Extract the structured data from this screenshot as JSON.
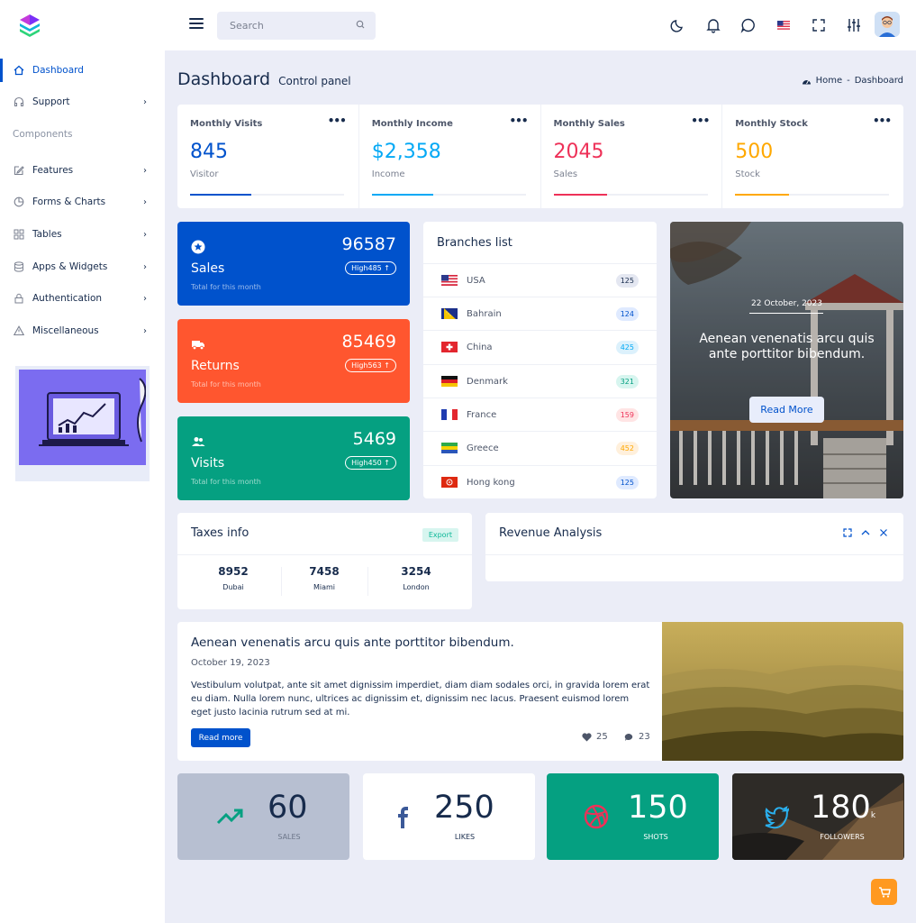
{
  "header": {
    "search_placeholder": "Search"
  },
  "sidebar": {
    "items": [
      {
        "label": "Dashboard",
        "icon": "home-icon",
        "active": true
      },
      {
        "label": "Support",
        "icon": "headphones-icon"
      },
      {
        "label": "Features",
        "icon": "edit-icon"
      },
      {
        "label": "Forms & Charts",
        "icon": "pie-chart-icon"
      },
      {
        "label": "Tables",
        "icon": "grid-icon"
      },
      {
        "label": "Apps & Widgets",
        "icon": "database-icon"
      },
      {
        "label": "Authentication",
        "icon": "lock-icon"
      },
      {
        "label": "Miscellaneous",
        "icon": "warning-icon"
      }
    ],
    "section_heading": "Components"
  },
  "page": {
    "title": "Dashboard",
    "subtitle": "Control panel",
    "breadcrumb_home": "Home",
    "breadcrumb_sep": "-",
    "breadcrumb_current": "Dashboard"
  },
  "stats": [
    {
      "label": "Monthly Visits",
      "value": "845",
      "sub": "Visitor",
      "color": "#0052cc",
      "progress": 0.4
    },
    {
      "label": "Monthly Income",
      "value": "$2,358",
      "sub": "Income",
      "color": "#04a9f5",
      "progress": 0.4
    },
    {
      "label": "Monthly Sales",
      "value": "2045",
      "sub": "Sales",
      "color": "#ee3158",
      "progress": 0.35
    },
    {
      "label": "Monthly Stock",
      "value": "500",
      "sub": "Stock",
      "color": "#ffa800",
      "progress": 0.35
    }
  ],
  "stats_menu": "•••",
  "big_cards": [
    {
      "title": "Sales",
      "value": "96587",
      "badge": "High485",
      "sub": "Total for this month",
      "color": "#0052cc",
      "icon": "star-icon"
    },
    {
      "title": "Returns",
      "value": "85469",
      "badge": "High563",
      "sub": "Total for this month",
      "color": "#ff562f",
      "icon": "truck-icon"
    },
    {
      "title": "Visits",
      "value": "5469",
      "badge": "High450",
      "sub": "Total for this month",
      "color": "#05a081",
      "icon": "users-icon"
    }
  ],
  "branches": {
    "title": "Branches list",
    "items": [
      {
        "name": "USA",
        "count": "125",
        "bg": "#e4e7f1",
        "fg": "#172b4c",
        "flag": "usa"
      },
      {
        "name": "Bahrain",
        "count": "124",
        "bg": "#dfeaff",
        "fg": "#0052cc",
        "flag": "bahrain"
      },
      {
        "name": "China",
        "count": "425",
        "bg": "#dcf1fc",
        "fg": "#04a9f5",
        "flag": "china"
      },
      {
        "name": "Denmark",
        "count": "321",
        "bg": "#d7f5ef",
        "fg": "#05a081",
        "flag": "denmark"
      },
      {
        "name": "France",
        "count": "159",
        "bg": "#ffe4e4",
        "fg": "#ee3158",
        "flag": "france"
      },
      {
        "name": "Greece",
        "count": "452",
        "bg": "#fff0dc",
        "fg": "#ffa800",
        "flag": "greece"
      },
      {
        "name": "Hong kong",
        "count": "125",
        "bg": "#dfeaff",
        "fg": "#0052cc",
        "flag": "hongkong"
      }
    ]
  },
  "hero": {
    "date": "22 October, 2023",
    "text": "Aenean venenatis arcu quis ante porttitor bibendum.",
    "button": "Read More"
  },
  "taxes": {
    "title": "Taxes info",
    "export": "Export",
    "items": [
      {
        "value": "8952",
        "label": "Dubai"
      },
      {
        "value": "7458",
        "label": "Miami"
      },
      {
        "value": "3254",
        "label": "London"
      }
    ]
  },
  "revenue": {
    "title": "Revenue Analysis"
  },
  "blog": {
    "title": "Aenean venenatis arcu quis ante porttitor bibendum.",
    "date": "October 19, 2023",
    "text": "Vestibulum volutpat, ante sit amet dignissim imperdiet, diam diam sodales orci, in gravida lorem erat eu diam. Nulla lorem nunc, ultrices ac dignissim et, dignissim nec lacus. Praesent euismod lorem eget justo lacinia rutrum sed at mi.",
    "button": "Read more",
    "likes": "25",
    "comments": "23"
  },
  "social": [
    {
      "value": "60",
      "label": "SALES",
      "bg": "#b7bfd1",
      "fg": "#172b4c",
      "icon": "trending-up-icon"
    },
    {
      "value": "250",
      "label": "LIKES",
      "bg": "#ffffff",
      "fg": "#172b4c",
      "icon": "facebook-icon"
    },
    {
      "value": "150",
      "label": "SHOTS",
      "bg": "#05a081",
      "fg": "#ffffff",
      "icon": "dribbble-icon"
    },
    {
      "value": "180",
      "suffix": "k",
      "label": "FOLLOWERS",
      "bg": "#3a3328",
      "fg": "#ffffff",
      "icon": "twitter-icon"
    }
  ]
}
